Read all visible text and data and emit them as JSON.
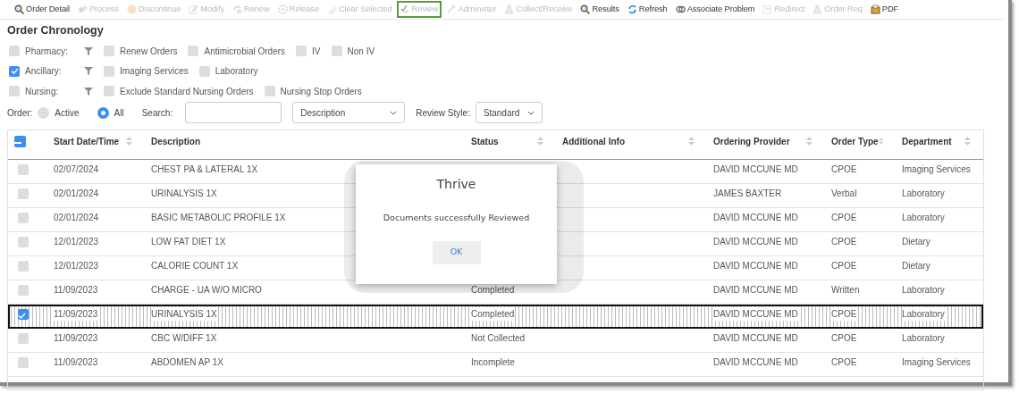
{
  "toolbar": [
    {
      "label": "Order Detail",
      "enabled": true,
      "highlighted": false
    },
    {
      "label": "Process",
      "enabled": false,
      "highlighted": false
    },
    {
      "label": "Discontinue",
      "enabled": false,
      "highlighted": false
    },
    {
      "label": "Modify",
      "enabled": false,
      "highlighted": false
    },
    {
      "label": "Renew",
      "enabled": false,
      "highlighted": false
    },
    {
      "label": "Release",
      "enabled": false,
      "highlighted": false
    },
    {
      "label": "Clear Selected",
      "enabled": false,
      "highlighted": false
    },
    {
      "label": "Review",
      "enabled": false,
      "highlighted": true
    },
    {
      "label": "Administer",
      "enabled": false,
      "highlighted": false
    },
    {
      "label": "Collect/Receive",
      "enabled": false,
      "highlighted": false
    },
    {
      "label": "Results",
      "enabled": true,
      "highlighted": false
    },
    {
      "label": "Refresh",
      "enabled": true,
      "highlighted": false
    },
    {
      "label": "Associate Problem",
      "enabled": true,
      "highlighted": false
    },
    {
      "label": "Redirect",
      "enabled": false,
      "highlighted": false
    },
    {
      "label": "Order Req",
      "enabled": false,
      "highlighted": false
    },
    {
      "label": "PDF",
      "enabled": true,
      "highlighted": false
    }
  ],
  "title": "Order Chronology",
  "filter_groups": [
    {
      "label": "Pharmacy:",
      "checked": false,
      "options": [
        {
          "label": "Renew Orders",
          "checked": false
        },
        {
          "label": "Antimicrobial Orders",
          "checked": false
        },
        {
          "label": "IV",
          "checked": false
        },
        {
          "label": "Non IV",
          "checked": false
        }
      ]
    },
    {
      "label": "Ancillary:",
      "checked": true,
      "options": [
        {
          "label": "Imaging Services",
          "checked": false
        },
        {
          "label": "Laboratory",
          "checked": false
        }
      ]
    },
    {
      "label": "Nursing:",
      "checked": false,
      "options": [
        {
          "label": "Exclude Standard Nursing Orders",
          "checked": false
        },
        {
          "label": "Nursing Stop Orders",
          "checked": false
        }
      ]
    }
  ],
  "order_filter": {
    "label": "Order:",
    "options": [
      {
        "label": "Active",
        "selected": false
      },
      {
        "label": "All",
        "selected": true
      }
    ]
  },
  "search": {
    "label": "Search:",
    "field_select": "Description"
  },
  "review_style": {
    "label": "Review Style:",
    "value": "Standard"
  },
  "table": {
    "select_all_indeterminate": true,
    "columns": [
      {
        "label": "Start Date/Time",
        "sortable": true
      },
      {
        "label": "Description",
        "sortable": false
      },
      {
        "label": "Status",
        "sortable": true
      },
      {
        "label": "Additional Info",
        "sortable": true
      },
      {
        "label": "Ordering Provider",
        "sortable": true
      },
      {
        "label": "Order Type",
        "sortable": true
      },
      {
        "label": "Department",
        "sortable": true
      }
    ],
    "rows": [
      {
        "selected": false,
        "cells": [
          "02/07/2024",
          "CHEST PA & LATERAL 1X",
          "",
          "",
          "DAVID MCCUNE MD",
          "CPOE",
          "Imaging Services"
        ]
      },
      {
        "selected": false,
        "cells": [
          "02/01/2024",
          "URINALYSIS 1X",
          "",
          "",
          "JAMES BAXTER",
          "Verbal",
          "Laboratory"
        ]
      },
      {
        "selected": false,
        "cells": [
          "02/01/2024",
          "BASIC METABOLIC PROFILE 1X",
          "",
          "",
          "DAVID MCCUNE MD",
          "CPOE",
          "Laboratory"
        ]
      },
      {
        "selected": false,
        "cells": [
          "12/01/2023",
          "LOW FAT DIET 1X",
          "",
          "",
          "DAVID MCCUNE MD",
          "CPOE",
          "Dietary"
        ]
      },
      {
        "selected": false,
        "cells": [
          "12/01/2023",
          "CALORIE COUNT 1X",
          "",
          "",
          "DAVID MCCUNE MD",
          "CPOE",
          "Dietary"
        ]
      },
      {
        "selected": false,
        "cells": [
          "11/09/2023",
          "CHARGE - UA W/O MICRO",
          "Completed",
          "",
          "DAVID MCCUNE MD",
          "Written",
          "Laboratory"
        ]
      },
      {
        "selected": true,
        "cells": [
          "11/09/2023",
          "URINALYSIS 1X",
          "Completed",
          "",
          "DAVID MCCUNE MD",
          "CPOE",
          "Laboratory"
        ]
      },
      {
        "selected": false,
        "cells": [
          "11/09/2023",
          "CBC W/DIFF 1X",
          "Not Collected",
          "",
          "DAVID MCCUNE MD",
          "CPOE",
          "Laboratory"
        ]
      },
      {
        "selected": false,
        "cells": [
          "11/09/2023",
          "ABDOMEN AP 1X",
          "Incomplete",
          "",
          "DAVID MCCUNE MD",
          "CPOE",
          "Imaging Services"
        ]
      }
    ]
  },
  "dialog": {
    "title": "Thrive",
    "message": "Documents successfully Reviewed",
    "button": "OK"
  }
}
